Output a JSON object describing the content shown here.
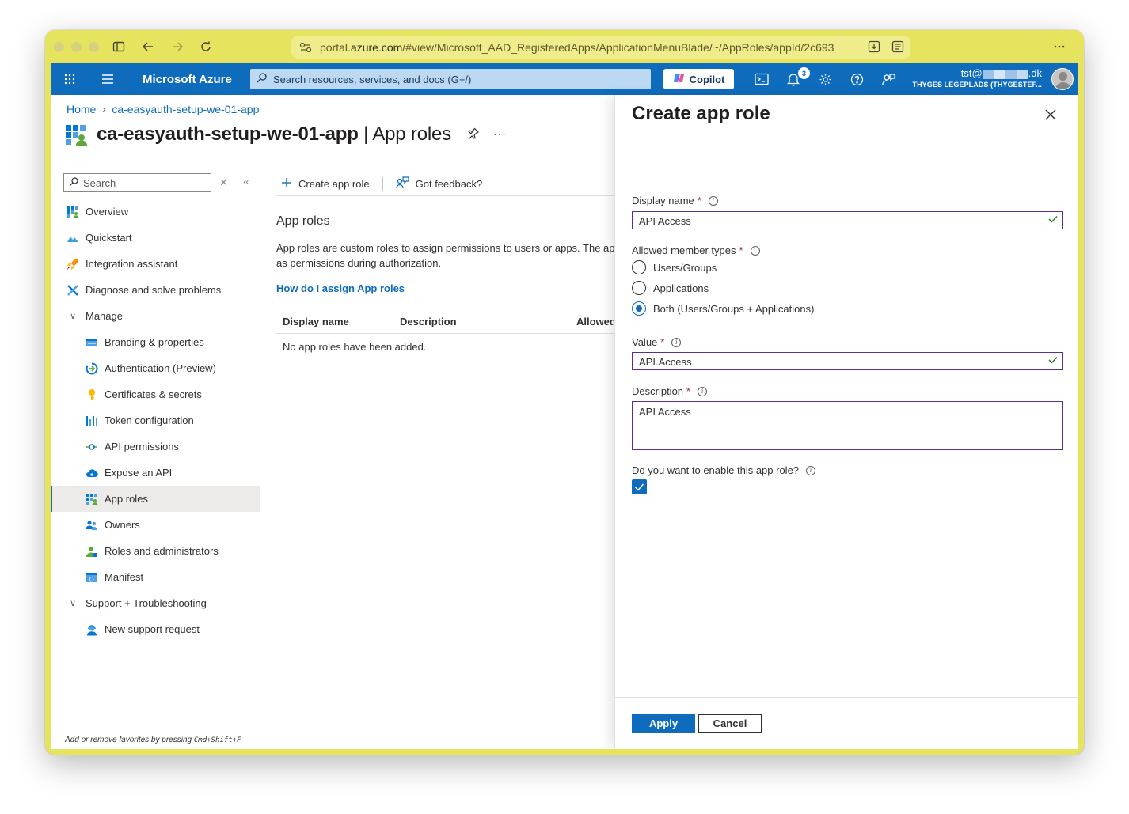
{
  "browser": {
    "url_prefix": "portal.",
    "url_host": "azure.com",
    "url_path": "/#view/Microsoft_AAD_RegisteredApps/ApplicationMenuBlade/~/AppRoles/appId/2c693"
  },
  "topbar": {
    "brand": "Microsoft Azure",
    "search_placeholder": "Search resources, services, and docs (G+/)",
    "copilot_label": "Copilot",
    "notification_count": "3",
    "user_prefix": "tst@",
    "user_suffix": ".dk",
    "tenant": "THYGES LEGEPLADS (THYGESTEF..."
  },
  "breadcrumb": {
    "home": "Home",
    "current": "ca-easyauth-setup-we-01-app"
  },
  "page": {
    "title_main": "ca-easyauth-setup-we-01-app",
    "title_sub": " | App roles"
  },
  "sidebar": {
    "search_placeholder": "Search",
    "items": [
      {
        "label": "Overview"
      },
      {
        "label": "Quickstart"
      },
      {
        "label": "Integration assistant"
      },
      {
        "label": "Diagnose and solve problems"
      },
      {
        "label": "Manage"
      },
      {
        "label": "Branding & properties"
      },
      {
        "label": "Authentication (Preview)"
      },
      {
        "label": "Certificates & secrets"
      },
      {
        "label": "Token configuration"
      },
      {
        "label": "API permissions"
      },
      {
        "label": "Expose an API"
      },
      {
        "label": "App roles"
      },
      {
        "label": "Owners"
      },
      {
        "label": "Roles and administrators"
      },
      {
        "label": "Manifest"
      },
      {
        "label": "Support + Troubleshooting"
      },
      {
        "label": "New support request"
      }
    ],
    "footer_hint_prefix": "Add or remove favorites by pressing ",
    "footer_hint_keys": "Cmd+Shift+F"
  },
  "content": {
    "cmd_create": "Create app role",
    "cmd_feedback": "Got feedback?",
    "heading": "App roles",
    "desc_line1": "App roles are custom roles to assign permissions to users or apps. The app",
    "desc_line2": "as permissions during authorization.",
    "link": "How do I assign App roles",
    "columns": [
      "Display name",
      "Description",
      "Allowed"
    ],
    "empty": "No app roles have been added."
  },
  "panel": {
    "title": "Create app role",
    "display_name_label": "Display name",
    "display_name_value": "API Access",
    "member_types_label": "Allowed member types",
    "radio_users": "Users/Groups",
    "radio_apps": "Applications",
    "radio_both": "Both (Users/Groups + Applications)",
    "value_label": "Value",
    "value_value": "API.Access",
    "description_label": "Description",
    "description_value": "API Access",
    "enable_label": "Do you want to enable this app role?",
    "enabled": true,
    "required_mark": "*",
    "apply": "Apply",
    "cancel": "Cancel"
  },
  "colors": {
    "window_tint": "#e6e35f",
    "azure_blue": "#0f6cbd",
    "input_border": "#5c2e91",
    "valid_check": "#107c10"
  }
}
